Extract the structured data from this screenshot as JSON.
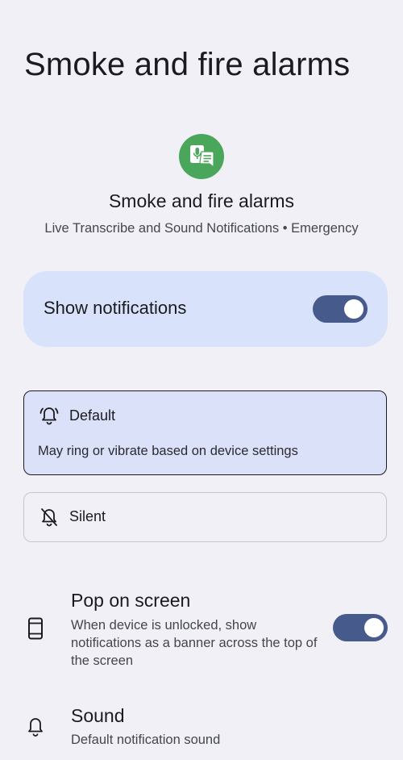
{
  "header": {
    "title": "Smoke and fire alarms"
  },
  "app_info": {
    "icon": "live-transcribe-icon",
    "name": "Smoke and fire alarms",
    "subtitle": "Live Transcribe and Sound Notifications • Emergency"
  },
  "master_toggle": {
    "label": "Show notifications",
    "state": "on"
  },
  "behavior_options": [
    {
      "title": "Default",
      "description": "May ring or vibrate based on device settings",
      "icon": "bell-icon",
      "selected": true
    },
    {
      "title": "Silent",
      "icon": "bell-off-icon",
      "selected": false
    }
  ],
  "settings": [
    {
      "title": "Pop on screen",
      "description": "When device is unlocked, show notifications as a banner across the top of the screen",
      "icon": "phone-icon",
      "toggle": "on"
    },
    {
      "title": "Sound",
      "description": "Default notification sound",
      "icon": "bell-icon"
    }
  ],
  "colors": {
    "background": "#f1f0f6",
    "accent": "#475a8c",
    "card": "#d9e2fb",
    "app_icon": "#4aa65a"
  }
}
